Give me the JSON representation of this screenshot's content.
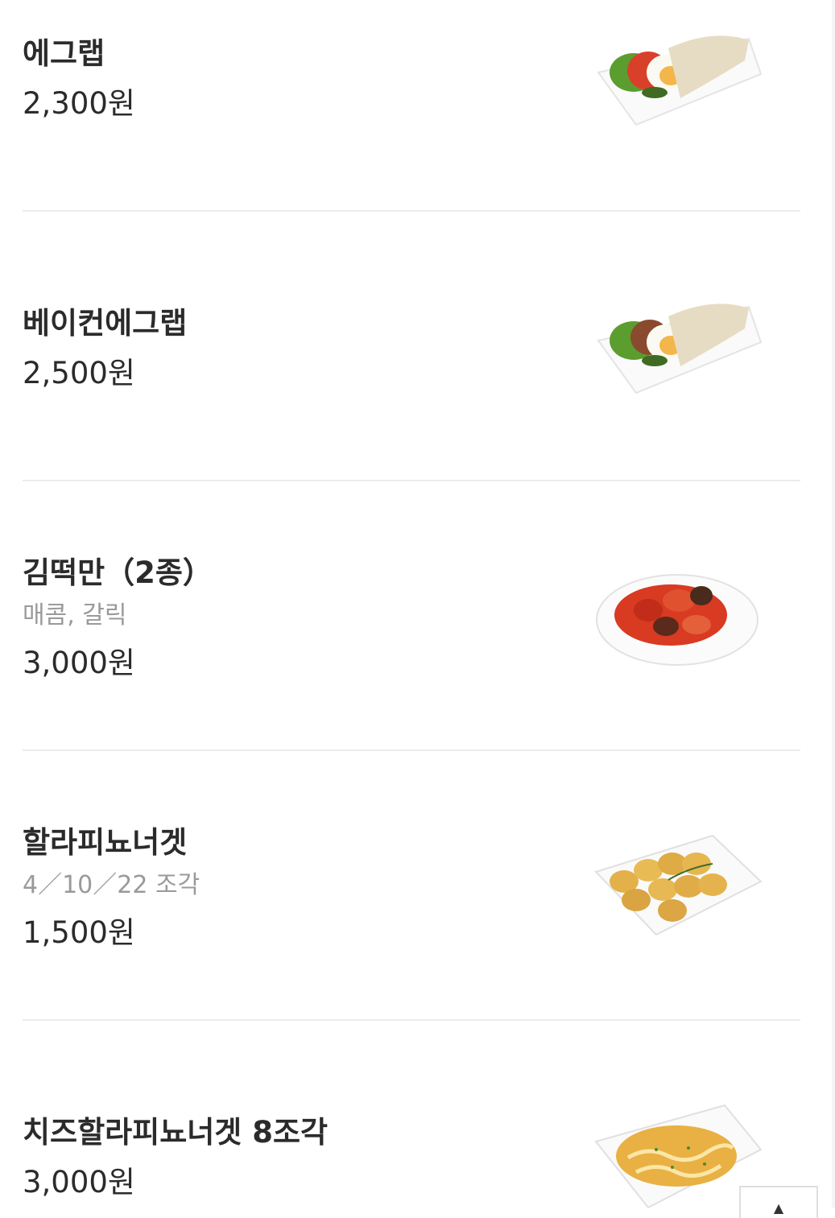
{
  "menu": {
    "items": [
      {
        "name": "에그랩",
        "price": "2,300원"
      },
      {
        "name": "베이컨에그랩",
        "price": "2,500원"
      },
      {
        "name": "김떡만（2종）",
        "desc": "매콤, 갈릭",
        "price": "3,000원"
      },
      {
        "name": "할라피뇨너겟",
        "desc": "4／10／22 조각",
        "price": "1,500원"
      },
      {
        "name": "치즈할라피뇨너겟 8조각",
        "price": "3,000원"
      }
    ]
  },
  "scroll_top": {
    "icon": "chevron-up-icon"
  },
  "colors": {
    "divider": "#ececec",
    "text": "#2b2b2b",
    "subtext": "#9a9a9a"
  }
}
